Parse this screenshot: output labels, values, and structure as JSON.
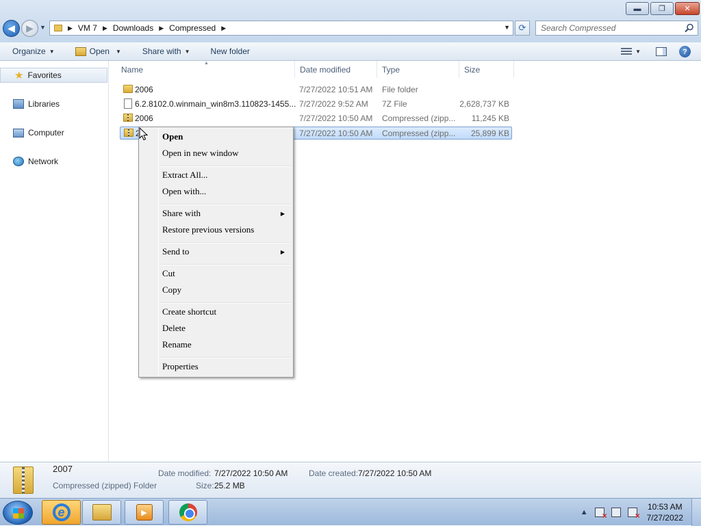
{
  "window": {
    "minimize": "▬",
    "maximize": "❐",
    "close": "✕"
  },
  "address": {
    "crumbs": [
      "VM 7",
      "Downloads",
      "Compressed"
    ]
  },
  "search": {
    "placeholder": "Search Compressed"
  },
  "toolbar": {
    "organize": "Organize",
    "open": "Open",
    "share_with": "Share with",
    "new_folder": "New folder"
  },
  "navpane": {
    "favorites": "Favorites",
    "libraries": "Libraries",
    "computer": "Computer",
    "network": "Network"
  },
  "columns": {
    "name": "Name",
    "date_modified": "Date modified",
    "type": "Type",
    "size": "Size"
  },
  "files": [
    {
      "name": "2006",
      "date": "7/27/2022 10:51 AM",
      "type": "File folder",
      "size": "",
      "icon": "folder-icon"
    },
    {
      "name": "6.2.8102.0.winmain_win8m3.110823-1455...",
      "date": "7/27/2022 9:52 AM",
      "type": "7Z File",
      "size": "2,628,737 KB",
      "icon": "file-icon"
    },
    {
      "name": "2006",
      "date": "7/27/2022 10:50 AM",
      "type": "Compressed (zipp...",
      "size": "11,245 KB",
      "icon": "zip-icon"
    },
    {
      "name": "2",
      "date": "7/27/2022 10:50 AM",
      "type": "Compressed (zipp...",
      "size": "25,899 KB",
      "icon": "zip-icon",
      "selected": true
    }
  ],
  "context_menu": {
    "open": "Open",
    "open_new_window": "Open in new window",
    "extract_all": "Extract All...",
    "open_with": "Open with...",
    "share_with": "Share with",
    "restore_previous": "Restore previous versions",
    "send_to": "Send to",
    "cut": "Cut",
    "copy": "Copy",
    "create_shortcut": "Create shortcut",
    "delete": "Delete",
    "rename": "Rename",
    "properties": "Properties"
  },
  "details": {
    "name": "2007",
    "type": "Compressed (zipped) Folder",
    "date_modified_label": "Date modified:",
    "date_modified": "7/27/2022 10:50 AM",
    "date_created_label": "Date created:",
    "date_created": "7/27/2022 10:50 AM",
    "size_label": "Size:",
    "size": "25.2 MB"
  },
  "taskbar": {
    "clock_time": "10:53 AM",
    "clock_date": "7/27/2022"
  }
}
